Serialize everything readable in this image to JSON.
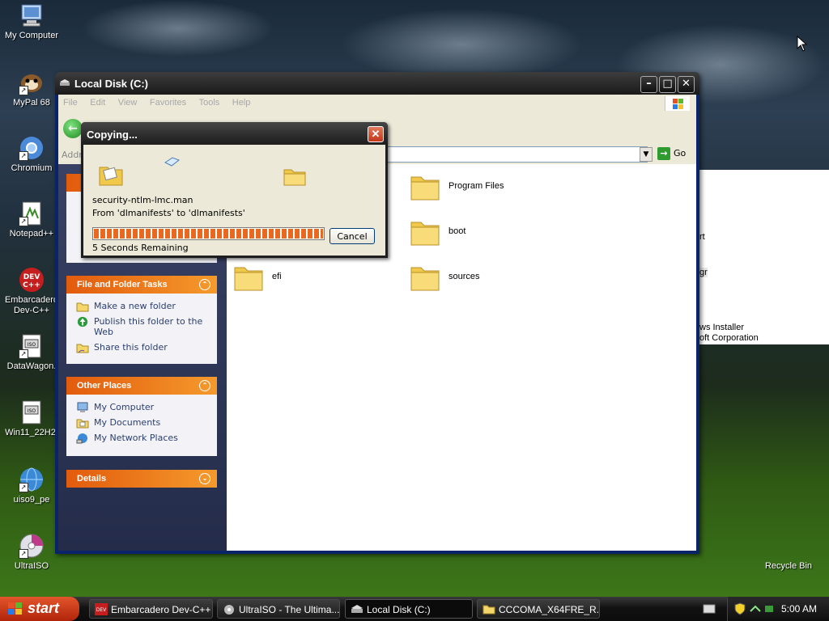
{
  "desktop": {
    "icons": [
      {
        "label": "My Computer"
      },
      {
        "label": "MyPal 68"
      },
      {
        "label": "Chromium"
      },
      {
        "label": "Notepad++"
      },
      {
        "label": "Embarcadero Dev-C++"
      },
      {
        "label": "DataWagon."
      },
      {
        "label": "Win11_22H2."
      },
      {
        "label": "uiso9_pe"
      },
      {
        "label": "UltraISO"
      },
      {
        "label": "Recycle Bin"
      }
    ]
  },
  "explorer": {
    "title": "Local Disk (C:)",
    "menu": [
      "File",
      "Edit",
      "View",
      "Favorites",
      "Tools",
      "Help"
    ],
    "address_label": "Addre",
    "go_label": "Go",
    "tasks": {
      "file_folder_header": "File and Folder Tasks",
      "file_folder_items": [
        "Make a new folder",
        "Publish this folder to the Web",
        "Share this folder"
      ],
      "other_places_header": "Other Places",
      "other_places_items": [
        "My Computer",
        "My Documents",
        "My Network Places"
      ],
      "details_header": "Details"
    },
    "folders": [
      "Program Files",
      "boot",
      "efi",
      "sources"
    ]
  },
  "copy_dialog": {
    "title": "Copying...",
    "file": "security-ntlm-lmc.man",
    "from_to": "From 'dlmanifests' to 'dlmanifests'",
    "remaining": "5 Seconds Remaining",
    "cancel": "Cancel",
    "progress_fraction": 1.0
  },
  "behind_window": {
    "texts": [
      "rt",
      "gr",
      "ws Installer",
      "oft Corporation"
    ]
  },
  "taskbar": {
    "start": "start",
    "tasks": [
      {
        "label": "Embarcadero Dev-C++"
      },
      {
        "label": "UltraISO - The Ultima..."
      },
      {
        "label": "Local Disk (C:)"
      },
      {
        "label": "CCCOMA_X64FRE_R..."
      }
    ],
    "clock": "5:00 AM"
  },
  "colors": {
    "task_header": "#e25b0d",
    "progress": "#e8691f",
    "link_text": "#2a3e6e"
  }
}
